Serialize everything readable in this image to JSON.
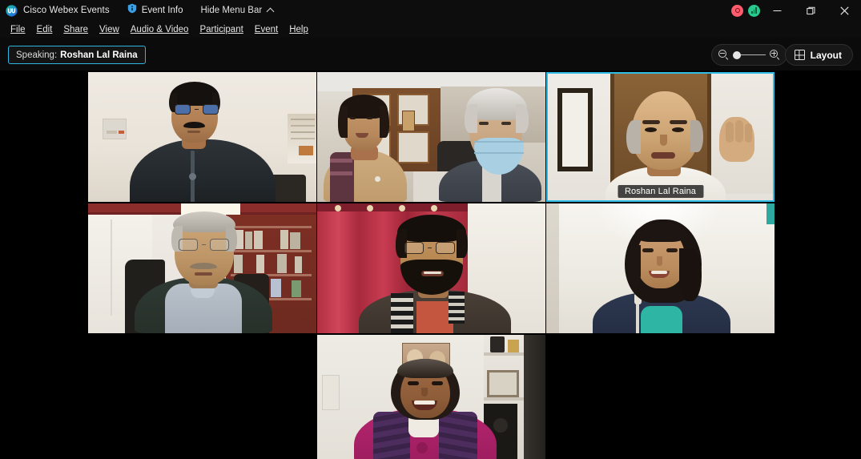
{
  "window": {
    "app_title": "Cisco Webex Events",
    "logo_icon": "webex-logo-icon",
    "event_info_label": "Event Info",
    "event_info_icon": "info-shield-icon",
    "hide_menu_label": "Hide Menu Bar",
    "hide_menu_icon": "chevron-up-icon",
    "recording_icon": "recording-indicator-icon",
    "network_icon": "network-strength-icon",
    "minimize_icon": "minimize-icon",
    "maximize_icon": "maximize-restore-icon",
    "close_icon": "close-icon",
    "accent_cyan": "#2fbde8",
    "recording_color": "#ff5d6e",
    "network_color": "#27c98d",
    "titlebar_bg": "#0d0d0d",
    "stage_bg": "#000000"
  },
  "menubar": {
    "items": [
      {
        "label": "File",
        "accel": "F"
      },
      {
        "label": "Edit",
        "accel": "E"
      },
      {
        "label": "Share",
        "accel": "S"
      },
      {
        "label": "View",
        "accel": "V"
      },
      {
        "label": "Audio & Video",
        "accel": "A"
      },
      {
        "label": "Participant",
        "accel": "P"
      },
      {
        "label": "Event",
        "accel": "t"
      },
      {
        "label": "Help",
        "accel": "H"
      }
    ]
  },
  "controls": {
    "speaking_prefix": "Speaking:",
    "speaking_name": "Roshan Lal Raina",
    "zoom_out_icon": "zoom-out-icon",
    "zoom_in_icon": "zoom-in-icon",
    "zoom_value": 12,
    "layout_label": "Layout",
    "layout_icon": "grid-layout-icon"
  },
  "stage": {
    "columns": 3,
    "participants": [
      {
        "id": "p1",
        "name": "",
        "name_visible": false,
        "active_speaker": false,
        "description": "Man with glasses and moustache in dark jacket, pale wall background"
      },
      {
        "id": "p2",
        "name": "",
        "name_visible": false,
        "active_speaker": false,
        "description": "Two people in an office: woman in tan jacket and older man wearing a blue surgical mask"
      },
      {
        "id": "p3",
        "name": "Roshan Lal Raina",
        "name_visible": true,
        "active_speaker": true,
        "description": "Bald man with raised hand, wooden door and framed picture behind"
      },
      {
        "id": "p4",
        "name": "",
        "name_visible": false,
        "active_speaker": false,
        "description": "Older man with glasses in grey sweater, wooden bookshelf behind"
      },
      {
        "id": "p5",
        "name": "",
        "name_visible": false,
        "active_speaker": false,
        "description": "Bearded man with glasses in dark blazer and scarf, red curtain background"
      },
      {
        "id": "p6",
        "name": "",
        "name_visible": false,
        "active_speaker": false,
        "description": "Woman in navy blazer with teal top, plain light wall"
      },
      {
        "id": "p7",
        "name": "",
        "name_visible": false,
        "active_speaker": false,
        "description": "Smiling woman in magenta and purple top, shelving and framed art behind"
      }
    ]
  }
}
